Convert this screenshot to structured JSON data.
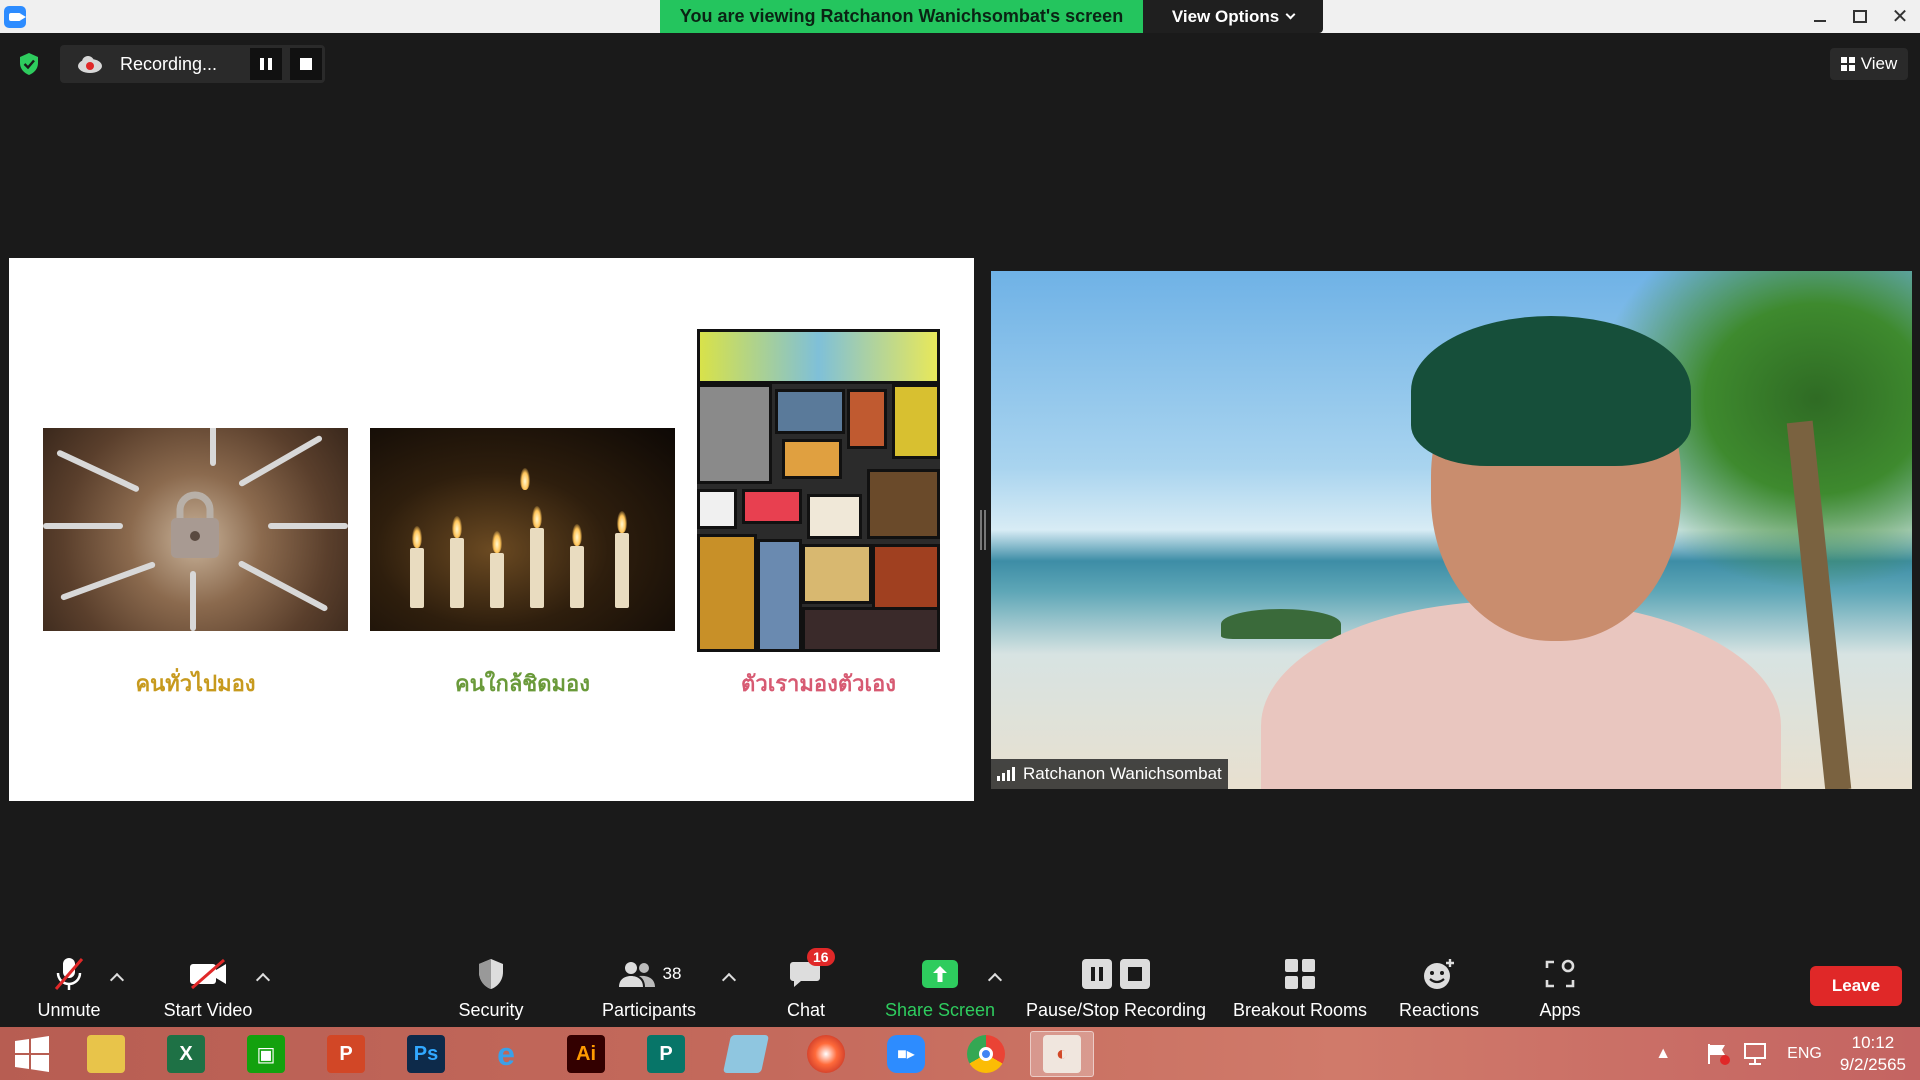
{
  "titlebar": {
    "banner_text": "You are viewing Ratchanon Wanichsombat's screen",
    "view_options_label": "View Options"
  },
  "recording": {
    "status_text": "Recording..."
  },
  "view_button_label": "View",
  "slide": {
    "captions": [
      "คนทั่วไปมอง",
      "คนใกล้ชิดมอง",
      "ตัวเรามองตัวเอง"
    ],
    "caption_colors": [
      "#c79a1e",
      "#6a9a3a",
      "#d75a72"
    ]
  },
  "video": {
    "participant_name": "Ratchanon Wanichsombat"
  },
  "toolbar": {
    "unmute_label": "Unmute",
    "start_video_label": "Start Video",
    "security_label": "Security",
    "participants_label": "Participants",
    "participants_count": "38",
    "chat_label": "Chat",
    "chat_badge": "16",
    "share_screen_label": "Share Screen",
    "pause_stop_recording_label": "Pause/Stop Recording",
    "breakout_rooms_label": "Breakout Rooms",
    "reactions_label": "Reactions",
    "apps_label": "Apps",
    "leave_label": "Leave"
  },
  "taskbar": {
    "apps": [
      "start",
      "file-explorer",
      "excel",
      "store",
      "powerpoint",
      "photoshop",
      "internet-explorer",
      "illustrator",
      "publisher",
      "notepad",
      "photoscape",
      "zoom",
      "chrome",
      "slides-app"
    ],
    "language": "ENG",
    "time": "10:12",
    "date": "9/2/2565"
  },
  "colors": {
    "banner_green": "#24c55e",
    "leave_red": "#e02828",
    "accent_blue": "#2d8cff"
  }
}
